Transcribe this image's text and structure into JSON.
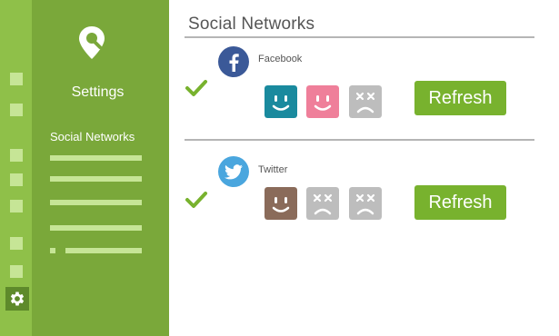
{
  "sidebar": {
    "title": "Settings",
    "active_item": "Social Networks"
  },
  "main": {
    "title": "Social Networks"
  },
  "networks": [
    {
      "name": "Facebook",
      "icon": "facebook-icon",
      "icon_color": "#3b5998",
      "status": "check-icon",
      "faces": [
        {
          "mood": "happy",
          "color": "#1a8a9e"
        },
        {
          "mood": "happy",
          "color": "#ef7f9a"
        },
        {
          "mood": "dead",
          "color": "#bdbdbd"
        }
      ],
      "refresh_label": "Refresh"
    },
    {
      "name": "Twitter",
      "icon": "twitter-icon",
      "icon_color": "#4aa6de",
      "status": "check-icon",
      "faces": [
        {
          "mood": "happy",
          "color": "#8a6b5a"
        },
        {
          "mood": "dead",
          "color": "#bdbdbd"
        },
        {
          "mood": "dead",
          "color": "#bdbdbd"
        }
      ],
      "refresh_label": "Refresh"
    }
  ],
  "colors": {
    "rail": "#8fc049",
    "sidebar": "#7aa83a",
    "accent": "#78b22e"
  }
}
